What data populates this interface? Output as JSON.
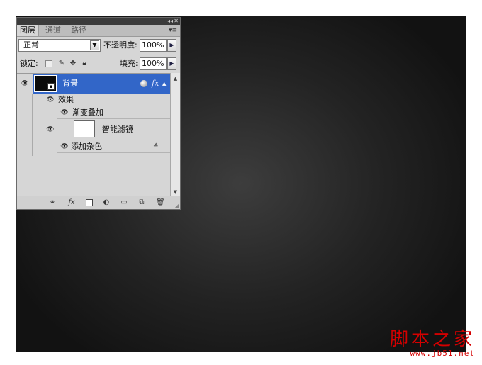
{
  "panel": {
    "tabs": [
      {
        "label": "图层",
        "active": true
      },
      {
        "label": "通道",
        "active": false
      },
      {
        "label": "路径",
        "active": false
      }
    ],
    "blend_mode": "正常",
    "opacity_label": "不透明度:",
    "opacity_value": "100%",
    "lock_label": "锁定:",
    "fill_label": "填充:",
    "fill_value": "100%"
  },
  "layers": {
    "background": {
      "name": "背景",
      "selected": true
    },
    "effects_label": "效果",
    "effect_items": [
      {
        "name": "渐变叠加"
      }
    ],
    "smart_filters_label": "智能滤镜",
    "filter_items": [
      {
        "name": "添加杂色"
      }
    ]
  },
  "bottom_toolbar": {
    "icons": [
      "link-icon",
      "fx-icon",
      "mask-icon",
      "adjustment-icon",
      "folder-icon",
      "new-layer-icon",
      "trash-icon"
    ],
    "fx_label": "fx"
  },
  "colors": {
    "selection": "#3266c8",
    "panel_bg": "#d6d6d6",
    "watermark": "#d40000"
  },
  "watermark": {
    "main": "脚本之家",
    "sub": "www.jb51.net"
  }
}
